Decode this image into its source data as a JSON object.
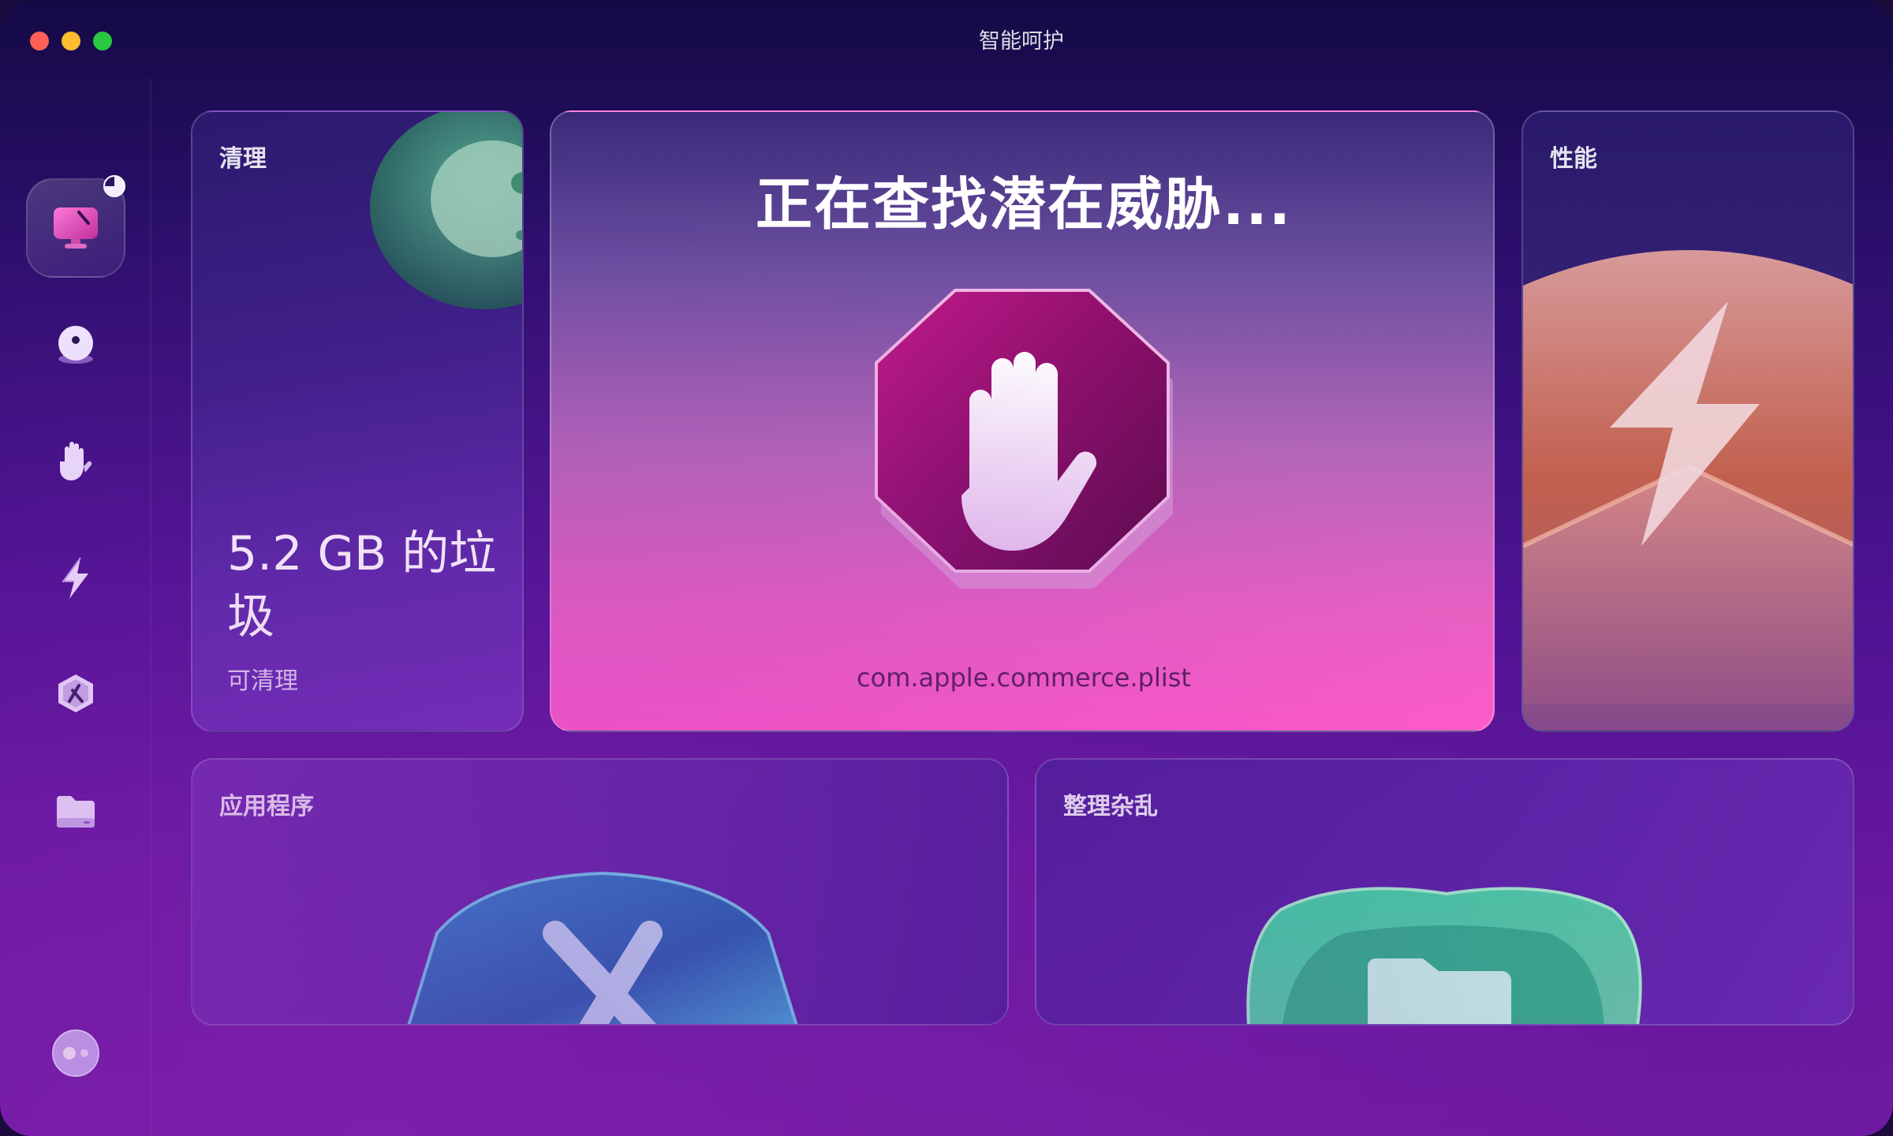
{
  "window": {
    "title": "智能呵护"
  },
  "sidebar": {
    "items": [
      {
        "name": "smart-care",
        "icon": "monitor-icon",
        "active": true,
        "progress": 0.25
      },
      {
        "name": "cleanup",
        "icon": "bubble-icon"
      },
      {
        "name": "protection",
        "icon": "hand-icon"
      },
      {
        "name": "performance",
        "icon": "lightning-icon"
      },
      {
        "name": "applications",
        "icon": "app-hex-icon"
      },
      {
        "name": "clutter",
        "icon": "folder-icon"
      }
    ],
    "assistant_icon": "assistant-icon"
  },
  "cards": {
    "cleanup": {
      "title": "清理",
      "value": "5.2 GB 的垃圾",
      "sub": "可清理"
    },
    "protection": {
      "heading": "正在查找潜在威胁...",
      "current_file": "com.apple.commerce.plist"
    },
    "performance": {
      "title": "性能"
    },
    "applications": {
      "title": "应用程序"
    },
    "clutter": {
      "title": "整理杂乱"
    }
  },
  "colors": {
    "accent_pink": "#ff5cc8",
    "window_dark": "#140a45",
    "window_purple": "#6e1aa0"
  }
}
